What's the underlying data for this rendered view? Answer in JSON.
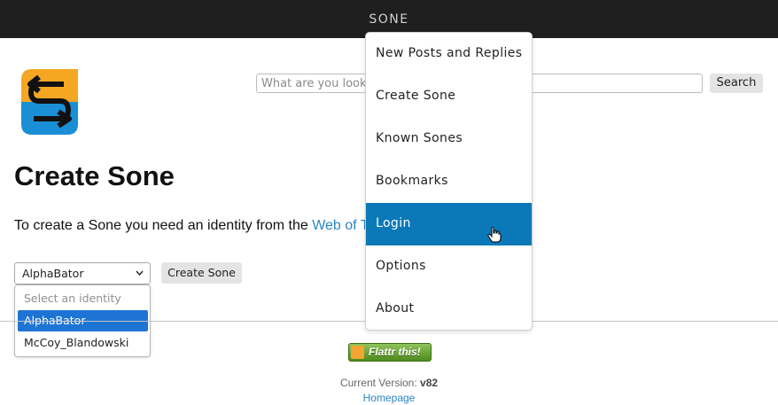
{
  "header": {
    "brand": "SONE"
  },
  "search": {
    "placeholder": "What are you looking for?",
    "button_label": "Search"
  },
  "page": {
    "title": "Create Sone",
    "intro_text": "To create a Sone you need an identity from the ",
    "intro_link": "Web of Trust"
  },
  "identity_select": {
    "selected_value": "AlphaBator",
    "options": [
      {
        "label": "Select an identity"
      },
      {
        "label": "AlphaBator"
      },
      {
        "label": "McCoy_Blandowski"
      }
    ]
  },
  "create_button": {
    "label": "Create Sone"
  },
  "nav_menu": {
    "items": [
      {
        "label": "New Posts and Replies"
      },
      {
        "label": "Create Sone"
      },
      {
        "label": "Known Sones"
      },
      {
        "label": "Bookmarks"
      },
      {
        "label": "Login"
      },
      {
        "label": "Options"
      },
      {
        "label": "About"
      }
    ],
    "active_item": "Login"
  },
  "footer": {
    "flattr_label": "Flattr this!",
    "version_label": "Current Version:",
    "version_value": "v82",
    "homepage_link": "Homepage"
  },
  "icons": {
    "logo": "sone-logo-icon",
    "chevron": "chevron-down-icon",
    "flattr": "flattr-icon",
    "cursor": "hand-pointer-icon"
  },
  "colors": {
    "topbar": "#1f1f1f",
    "link": "#2b86c4",
    "menu_active": "#0b78b8",
    "select_highlight": "#1e74d4",
    "logo_orange": "#f5a623",
    "logo_blue": "#1b8fd6"
  }
}
